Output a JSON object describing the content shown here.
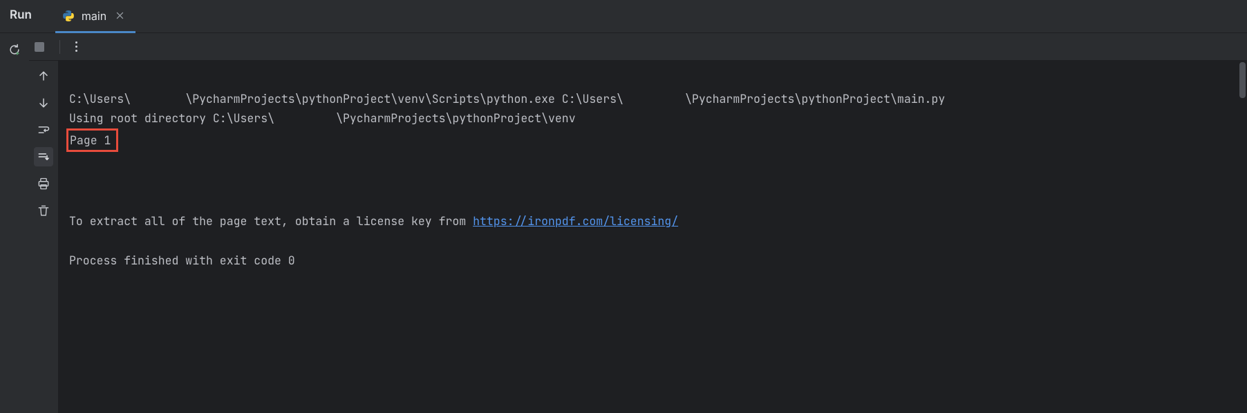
{
  "header": {
    "run_label": "Run",
    "tab": {
      "label": "main",
      "icon_name": "python-icon"
    }
  },
  "console": {
    "line1_a": "C:\\Users\\",
    "line1_b": "\\PycharmProjects\\pythonProject\\venv\\Scripts\\python.exe C:\\Users\\",
    "line1_c": "\\PycharmProjects\\pythonProject\\main.py ",
    "line2_a": "Using root directory C:\\Users\\",
    "line2_b": "\\PycharmProjects\\pythonProject\\venv",
    "line3": "Page 1",
    "line_license_prefix": "To extract all of the page text, obtain a license key from ",
    "license_url": "https://ironpdf.com/licensing/",
    "exit_line": "Process finished with exit code 0"
  }
}
